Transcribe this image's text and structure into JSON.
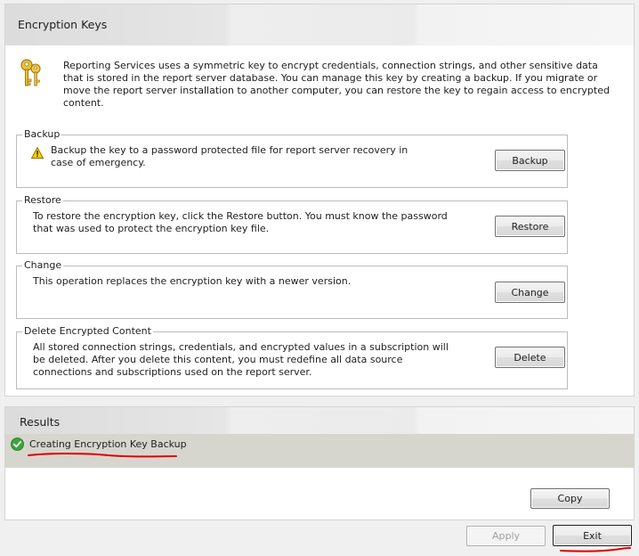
{
  "panel": {
    "title": "Encryption Keys",
    "intro": "Reporting Services uses a symmetric key to encrypt credentials, connection strings, and other sensitive data that is stored in the report server database.  You can manage this key by creating a backup.  If you migrate or move the report server installation to another computer, you can restore the key to regain access to encrypted content.",
    "icon": "key-icon"
  },
  "groups": {
    "backup": {
      "legend": "Backup",
      "text": "Backup the key to a password protected file for report server recovery in case of emergency.",
      "button": "Backup",
      "icon": "warning-icon"
    },
    "restore": {
      "legend": "Restore",
      "text": "To restore the encryption key, click the Restore button.  You must know the password that was used to protect the encryption key file.",
      "button": "Restore"
    },
    "change": {
      "legend": "Change",
      "text": "This operation replaces the encryption key with a newer version.",
      "button": "Change"
    },
    "delete": {
      "legend": "Delete Encrypted Content",
      "text": "All stored connection strings, credentials, and encrypted values in a subscription will be deleted.  After you delete this content, you must redefine all data source connections and subscriptions used on the report server.",
      "button": "Delete"
    }
  },
  "results": {
    "title": "Results",
    "status_icon": "success-check-icon",
    "message": "Creating Encryption Key Backup",
    "copy_button": "Copy"
  },
  "footer": {
    "apply_button": "Apply",
    "exit_button": "Exit"
  },
  "colors": {
    "annotation_red": "#e00000",
    "success_green": "#3aa53a",
    "warning_yellow": "#f5d000"
  }
}
